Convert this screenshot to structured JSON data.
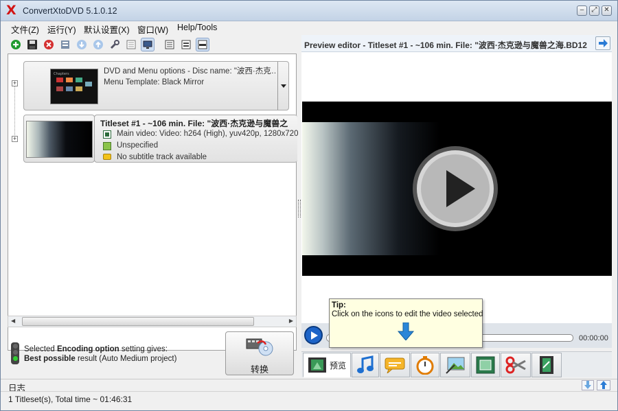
{
  "window": {
    "title": "ConvertXtoDVD 5.1.0.12"
  },
  "menu": [
    "文件(Z)",
    "运行(Y)",
    "默认设置(X)",
    "窗口(W)",
    "Help/Tools"
  ],
  "toolbar": {
    "icons": [
      "add-icon",
      "save-icon",
      "remove-icon",
      "properties-icon",
      "move-down-icon",
      "move-up-icon",
      "settings-icon",
      "menu-layout-icon",
      "monitor-icon",
      "view-list-icon",
      "view-detail-icon",
      "view-compact-icon"
    ]
  },
  "dvd_menu": {
    "line1": "DVD and Menu options - Disc name: \"波西·杰克…",
    "line2": "Menu Template: Black Mirror"
  },
  "titleset": {
    "title": "Titleset #1 - ~106 min. File: \"波西·杰克逊与魔兽之",
    "video": "Main video: Video: h264 (High), yuv420p, 1280x720 [I",
    "audio": "Unspecified",
    "subtitle": "No subtitle track available"
  },
  "status": {
    "prefix": "Selected ",
    "bold1": "Encoding option",
    "mid": " setting gives:",
    "bold2": "Best possible",
    "suffix": " result (Auto Medium project)"
  },
  "convert": {
    "label": "转换"
  },
  "preview": {
    "header": "Preview editor - Titleset #1 - ~106 min. File: \"波西·杰克逊与魔兽之海.BD12",
    "time": "00:00:00"
  },
  "tip": {
    "title": "Tip:",
    "body": "Click on the icons to edit the video selected"
  },
  "edit_tabs": {
    "preview_label": "预览"
  },
  "log": {
    "label": "日志"
  },
  "statusbar": {
    "text": "1 Titleset(s), Total time ~ 01:46:31"
  }
}
